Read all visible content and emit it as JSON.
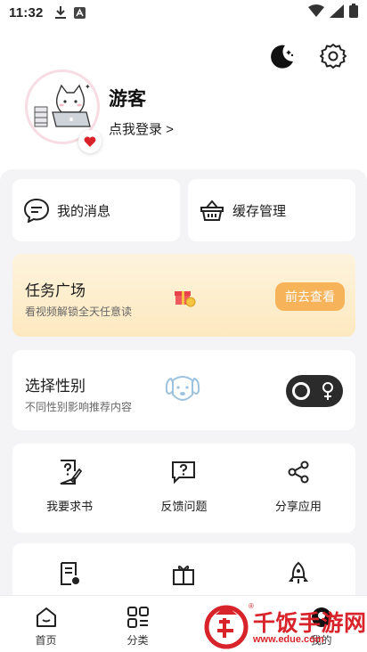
{
  "status_bar": {
    "time": "11:32"
  },
  "profile": {
    "username": "游客",
    "login_link": "点我登录 >"
  },
  "quick_cards": [
    {
      "label": "我的消息",
      "icon": "message-icon"
    },
    {
      "label": "缓存管理",
      "icon": "basket-icon"
    }
  ],
  "task": {
    "title": "任务广场",
    "subtitle": "看视频解锁全天任意读",
    "button": "前去查看"
  },
  "gender": {
    "title": "选择性别",
    "subtitle": "不同性别影响推荐内容"
  },
  "tools": [
    {
      "label": "我要求书",
      "icon": "request-book-icon"
    },
    {
      "label": "反馈问题",
      "icon": "feedback-icon"
    },
    {
      "label": "分享应用",
      "icon": "share-icon"
    }
  ],
  "bottom_nav": [
    {
      "label": "首页",
      "icon": "home-icon"
    },
    {
      "label": "分类",
      "icon": "category-icon"
    },
    {
      "label": "",
      "icon": "bookshelf-icon"
    },
    {
      "label": "我的",
      "icon": "profile-icon"
    }
  ],
  "watermark": {
    "text": "千饭手游网",
    "url": "www.edue.com",
    "reg": "®"
  },
  "colors": {
    "accent": "#f7b35a",
    "background": "#f4f4f6",
    "heart": "#d9232a",
    "watermark": "#d9232a"
  }
}
